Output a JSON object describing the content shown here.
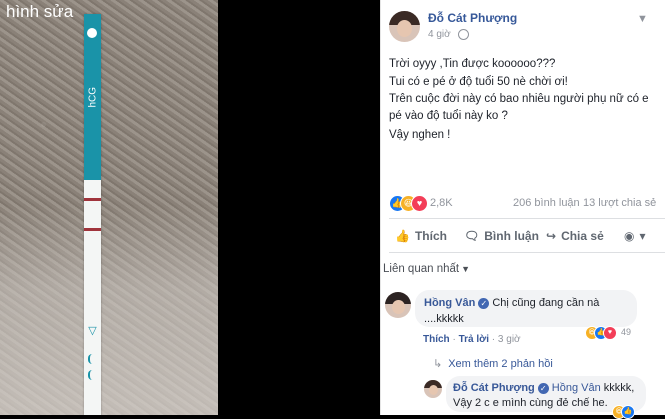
{
  "photo": {
    "caption": "hình sửa",
    "strip_label": "hCG"
  },
  "post": {
    "author": "Đỗ Cát Phượng",
    "time": "4 giờ",
    "lines": [
      "Trời oyyy ,Tin được koooooo???",
      "Tui có e pé ở độ tuổi 50 nè chời ơi!",
      "Trên cuộc đời này có bao nhiêu người phụ nữ có e",
      "pé vào độ tuổi này ko ?",
      "Vậy nghen !"
    ],
    "reaction_count": "2,8K",
    "comments_count": "206 bình luận",
    "shares_count": "13 lượt chia sẻ",
    "actions": {
      "like": "Thích",
      "comment": "Bình luận",
      "share": "Chia sẻ"
    }
  },
  "comments": {
    "sort_label": "Liên quan nhất",
    "first": {
      "name": "Hồng Vân",
      "text_1": "Chị cũng đang cần nà",
      "text_2": "....kkkkk",
      "like": "Thích",
      "reply": "Trả lời",
      "time": "3 giờ",
      "reaction_count": "49"
    },
    "see_more": "Xem thêm 2 phản hồi",
    "reply": {
      "name": "Đỗ Cát Phượng",
      "mention": "Hồng Vân",
      "text_1": "kkkkk,",
      "text_2": "Vậy 2 c e mình cùng đẻ chế he."
    }
  },
  "colors": {
    "link": "#365899",
    "like_blue": "#1877f2",
    "haha_yellow": "#f7b125",
    "love_red": "#f33e58",
    "strip_teal": "#1a93a8"
  }
}
